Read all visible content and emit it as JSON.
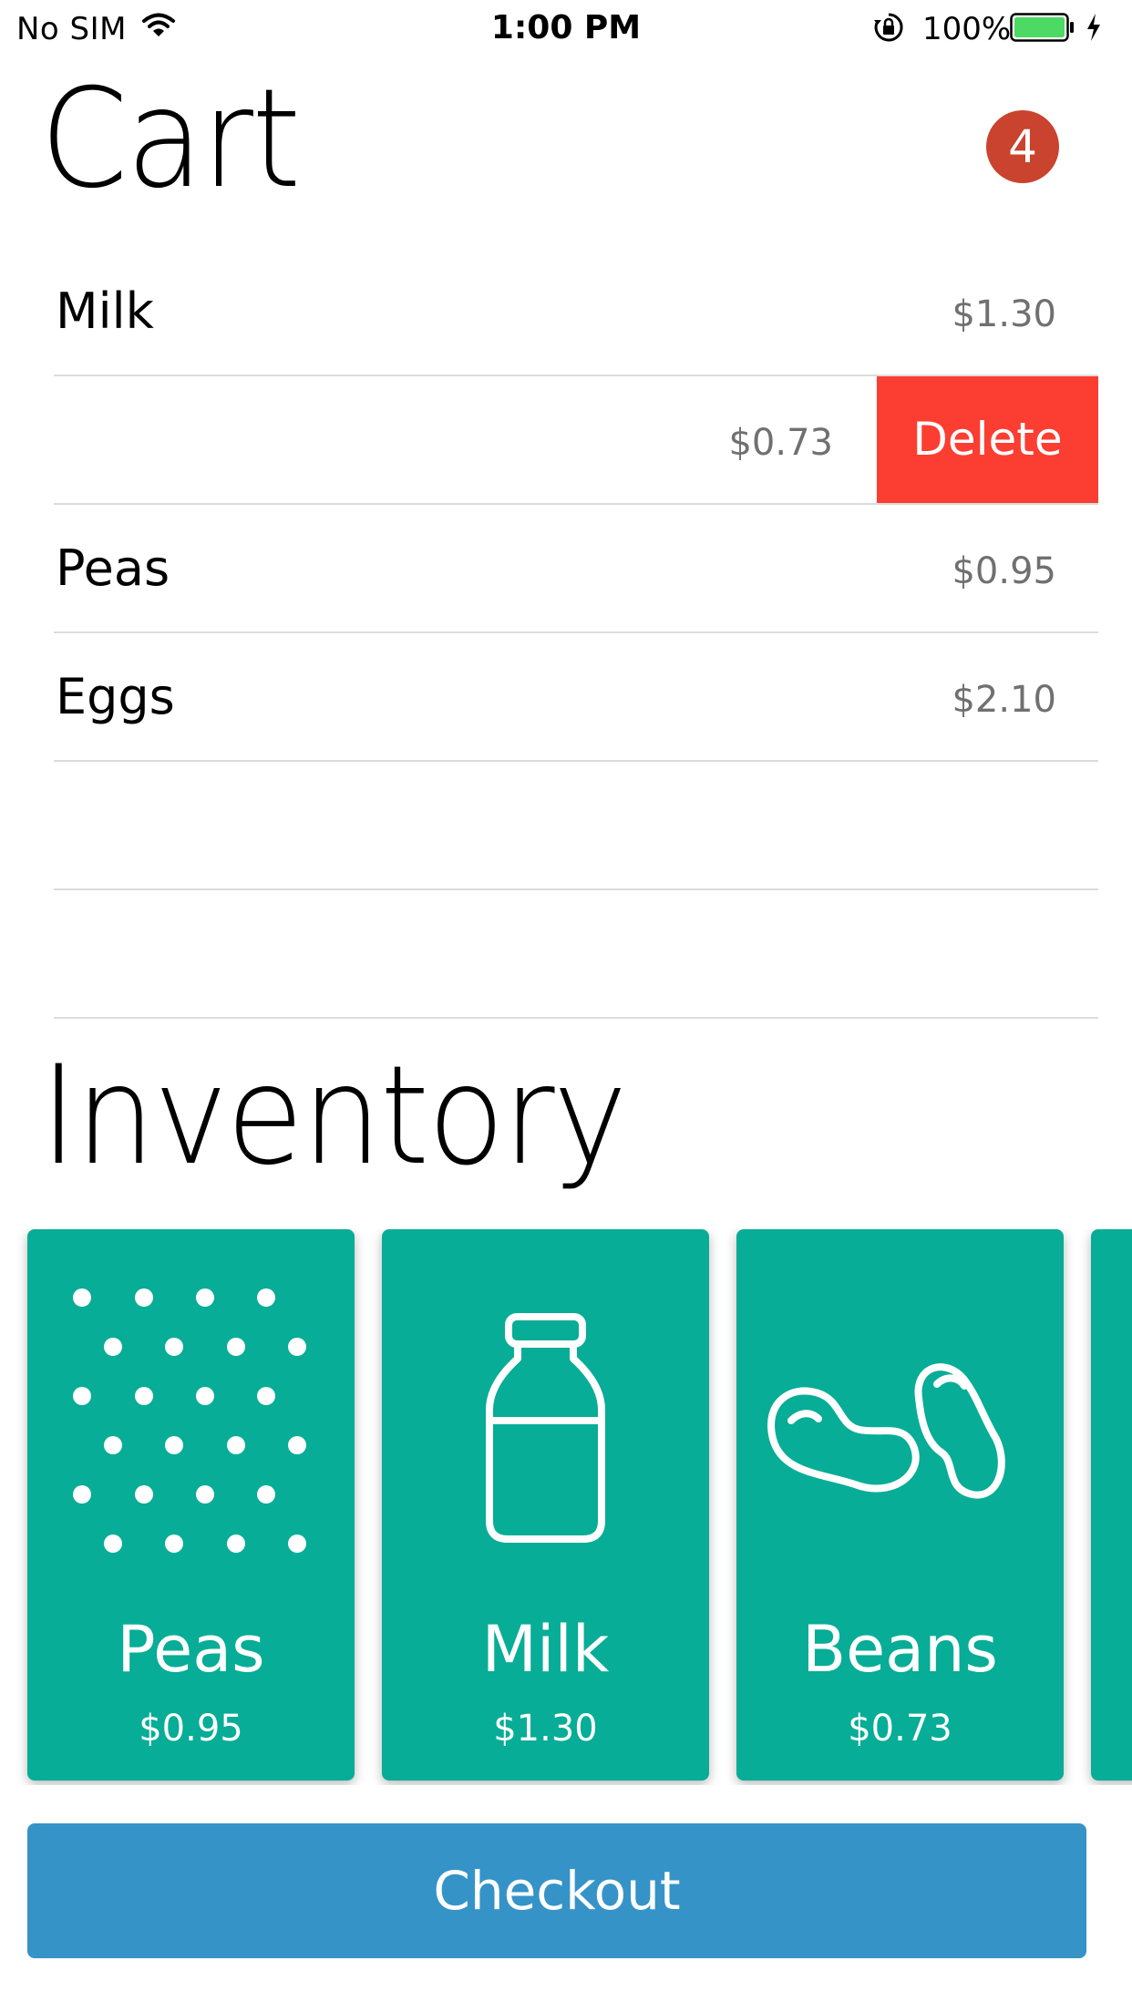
{
  "status_bar": {
    "carrier": "No SIM",
    "time": "1:00 PM",
    "battery_percent": "100%",
    "icons": [
      "wifi-icon",
      "lock-rotation-icon",
      "battery-icon",
      "charging-icon"
    ],
    "battery_color": "#4cd964"
  },
  "cart": {
    "title": "Cart",
    "count": "4",
    "badge_color": "#c9432e",
    "items": [
      {
        "name": "Milk",
        "price": "$1.30"
      },
      {
        "name": "",
        "price": "$0.73",
        "delete_label": "Delete"
      },
      {
        "name": "Peas",
        "price": "$0.95"
      },
      {
        "name": "Eggs",
        "price": "$2.10"
      }
    ],
    "delete_color": "#fc3d31"
  },
  "inventory": {
    "title": "Inventory",
    "card_color": "#07ad96",
    "cards": [
      {
        "name": "Peas",
        "price": "$0.95",
        "icon": "peas-icon"
      },
      {
        "name": "Milk",
        "price": "$1.30",
        "icon": "milk-bottle-icon"
      },
      {
        "name": "Beans",
        "price": "$0.73",
        "icon": "beans-icon"
      }
    ]
  },
  "checkout": {
    "label": "Checkout",
    "color": "#3593c7"
  }
}
